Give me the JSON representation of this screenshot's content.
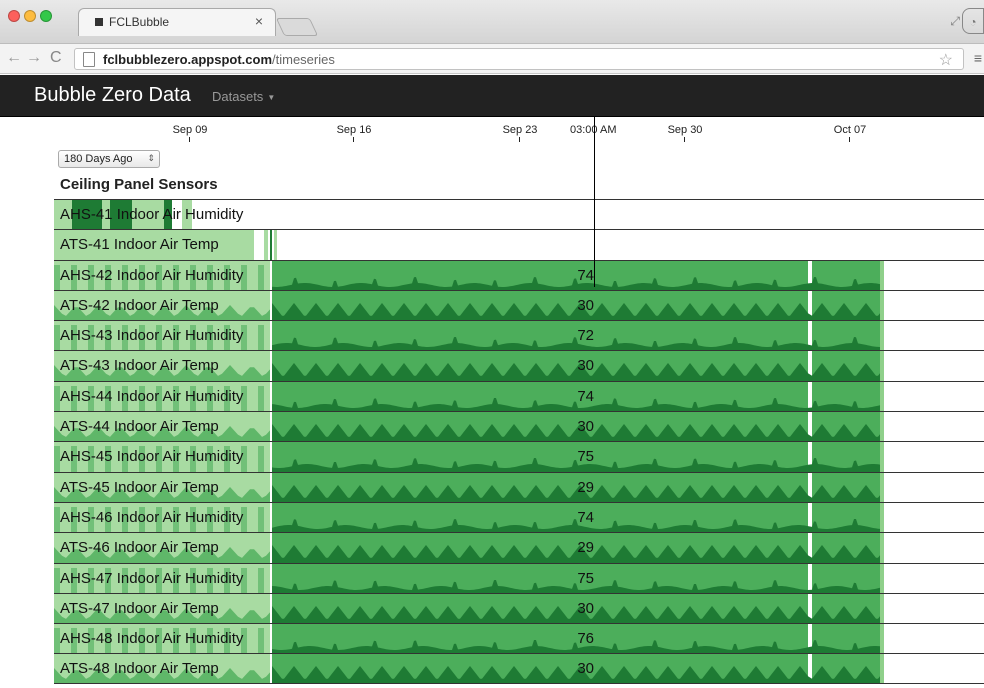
{
  "browser": {
    "tab_title": "FCLBubble",
    "tab_close": "×",
    "url_host": "fclbubblezero.appspot.com",
    "url_path": "/timeseries",
    "icons": {
      "back": "←",
      "forward": "→",
      "reload": "C",
      "star": "☆",
      "menu": "≡",
      "close": "×"
    }
  },
  "app": {
    "brand": "Bubble Zero Data",
    "nav_datasets": "Datasets",
    "range_select": "180 Days Ago",
    "section_title": "Ceiling Panel Sensors",
    "cursor_time": "03:00 AM"
  },
  "axis": {
    "ticks": [
      "Sep 09",
      "Sep 16",
      "Sep 23",
      "Sep 30",
      "Oct 07"
    ]
  },
  "colors": {
    "light_green": "#a8dba2",
    "mid_green": "#4cae5b",
    "dark_green": "#1e7b34"
  },
  "rows": [
    {
      "label": "AHS-41 Indoor Air Humidity",
      "value": "",
      "kind": "sparse-humidity"
    },
    {
      "label": "ATS-41 Indoor Air Temp",
      "value": "",
      "kind": "sparse-temp"
    },
    {
      "label": "AHS-42 Indoor Air Humidity",
      "value": "74",
      "kind": "humidity"
    },
    {
      "label": "ATS-42 Indoor Air Temp",
      "value": "30",
      "kind": "temp"
    },
    {
      "label": "AHS-43 Indoor Air Humidity",
      "value": "72",
      "kind": "humidity"
    },
    {
      "label": "ATS-43 Indoor Air Temp",
      "value": "30",
      "kind": "temp"
    },
    {
      "label": "AHS-44 Indoor Air Humidity",
      "value": "74",
      "kind": "humidity"
    },
    {
      "label": "ATS-44 Indoor Air Temp",
      "value": "30",
      "kind": "temp"
    },
    {
      "label": "AHS-45 Indoor Air Humidity",
      "value": "75",
      "kind": "humidity"
    },
    {
      "label": "ATS-45 Indoor Air Temp",
      "value": "29",
      "kind": "temp"
    },
    {
      "label": "AHS-46 Indoor Air Humidity",
      "value": "74",
      "kind": "humidity"
    },
    {
      "label": "ATS-46 Indoor Air Temp",
      "value": "29",
      "kind": "temp"
    },
    {
      "label": "AHS-47 Indoor Air Humidity",
      "value": "75",
      "kind": "humidity"
    },
    {
      "label": "ATS-47 Indoor Air Temp",
      "value": "30",
      "kind": "temp"
    },
    {
      "label": "AHS-48 Indoor Air Humidity",
      "value": "76",
      "kind": "humidity"
    },
    {
      "label": "ATS-48 Indoor Air Temp",
      "value": "30",
      "kind": "temp"
    }
  ]
}
